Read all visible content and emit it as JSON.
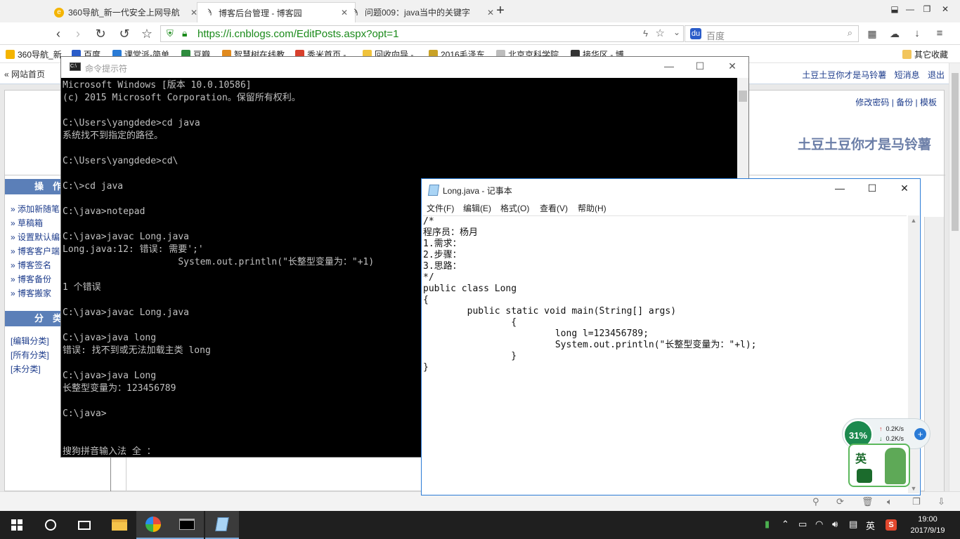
{
  "browser": {
    "tabs": [
      {
        "title": "360导航_新一代安全上网导航",
        "favicon": "360-icon"
      },
      {
        "title": "博客后台管理 - 博客园",
        "favicon": "cnblogs-icon"
      },
      {
        "title": "问题009：java当中的关键字",
        "favicon": "cnblogs-icon"
      }
    ],
    "new_tab": "+",
    "url": "https://i.cnblogs.com/EditPosts.aspx?opt=1",
    "search_placeholder": "百度",
    "bookmarks": [
      "360导航_新",
      "百度",
      "课堂派-简单",
      "豆瓣",
      "智慧树在线教",
      "秀米首页 -",
      "回收向导 -",
      "2016毛泽东",
      "北京京科学院",
      "接华区 - 博"
    ],
    "other_bookmarks": "其它收藏"
  },
  "page": {
    "home_link": "« 网站首页",
    "user_links": [
      "土豆土豆你才是马铃薯",
      "短消息",
      "退出"
    ],
    "blog_links": "修改密码 | 备份 | 模板",
    "blog_title": "土豆土豆你才是马铃薯",
    "ops_heading": "操　作",
    "ops_items": [
      "» 添加新随笔",
      "» 草稿箱",
      "» 设置默认编辑器",
      "» 博客客户端",
      "» 博客签名",
      "» 博客备份",
      "» 博客搬家"
    ],
    "cat_heading": "分　类",
    "cat_items": [
      "[编辑分类]",
      "[所有分类]",
      "[未分类]"
    ]
  },
  "cmd": {
    "title": "命令提示符",
    "lines": [
      "Microsoft Windows [版本 10.0.10586]",
      "(c) 2015 Microsoft Corporation。保留所有权利。",
      "",
      "C:\\Users\\yangdede>cd java",
      "系统找不到指定的路径。",
      "",
      "C:\\Users\\yangdede>cd\\",
      "",
      "C:\\>cd java",
      "",
      "C:\\java>notepad",
      "",
      "C:\\java>javac Long.java",
      "Long.java:12: 错误: 需要';'",
      "                     System.out.println(\"长整型变量为：\"+1)",
      "",
      "1 个错误",
      "",
      "C:\\java>javac Long.java",
      "",
      "C:\\java>java long",
      "错误: 找不到或无法加载主类 long",
      "",
      "C:\\java>java Long",
      "长整型变量为：123456789",
      "",
      "C:\\java>",
      "",
      "",
      "搜狗拼音输入法 全 ："
    ]
  },
  "notepad": {
    "title": "Long.java - 记事本",
    "menu": [
      "文件(F)",
      "编辑(E)",
      "格式(O)",
      "查看(V)",
      "帮助(H)"
    ],
    "lines": [
      "/*",
      "程序员：杨月",
      "1.需求：",
      "2.步骤：",
      "3.思路：",
      "*/",
      "public class Long",
      "{",
      "        public static void main(String[] args)",
      "                {",
      "                        long l=123456789;",
      "                        System.out.println(\"长整型变量为：\"+l);",
      "                }",
      "}"
    ]
  },
  "widgets": {
    "speed_percent": "31%",
    "upload": "0.2K/s",
    "download": "0.2K/s",
    "ime_label": "英"
  },
  "taskbar": {
    "ime_mode": "英",
    "time": "19:00",
    "date": "2017/9/19"
  }
}
